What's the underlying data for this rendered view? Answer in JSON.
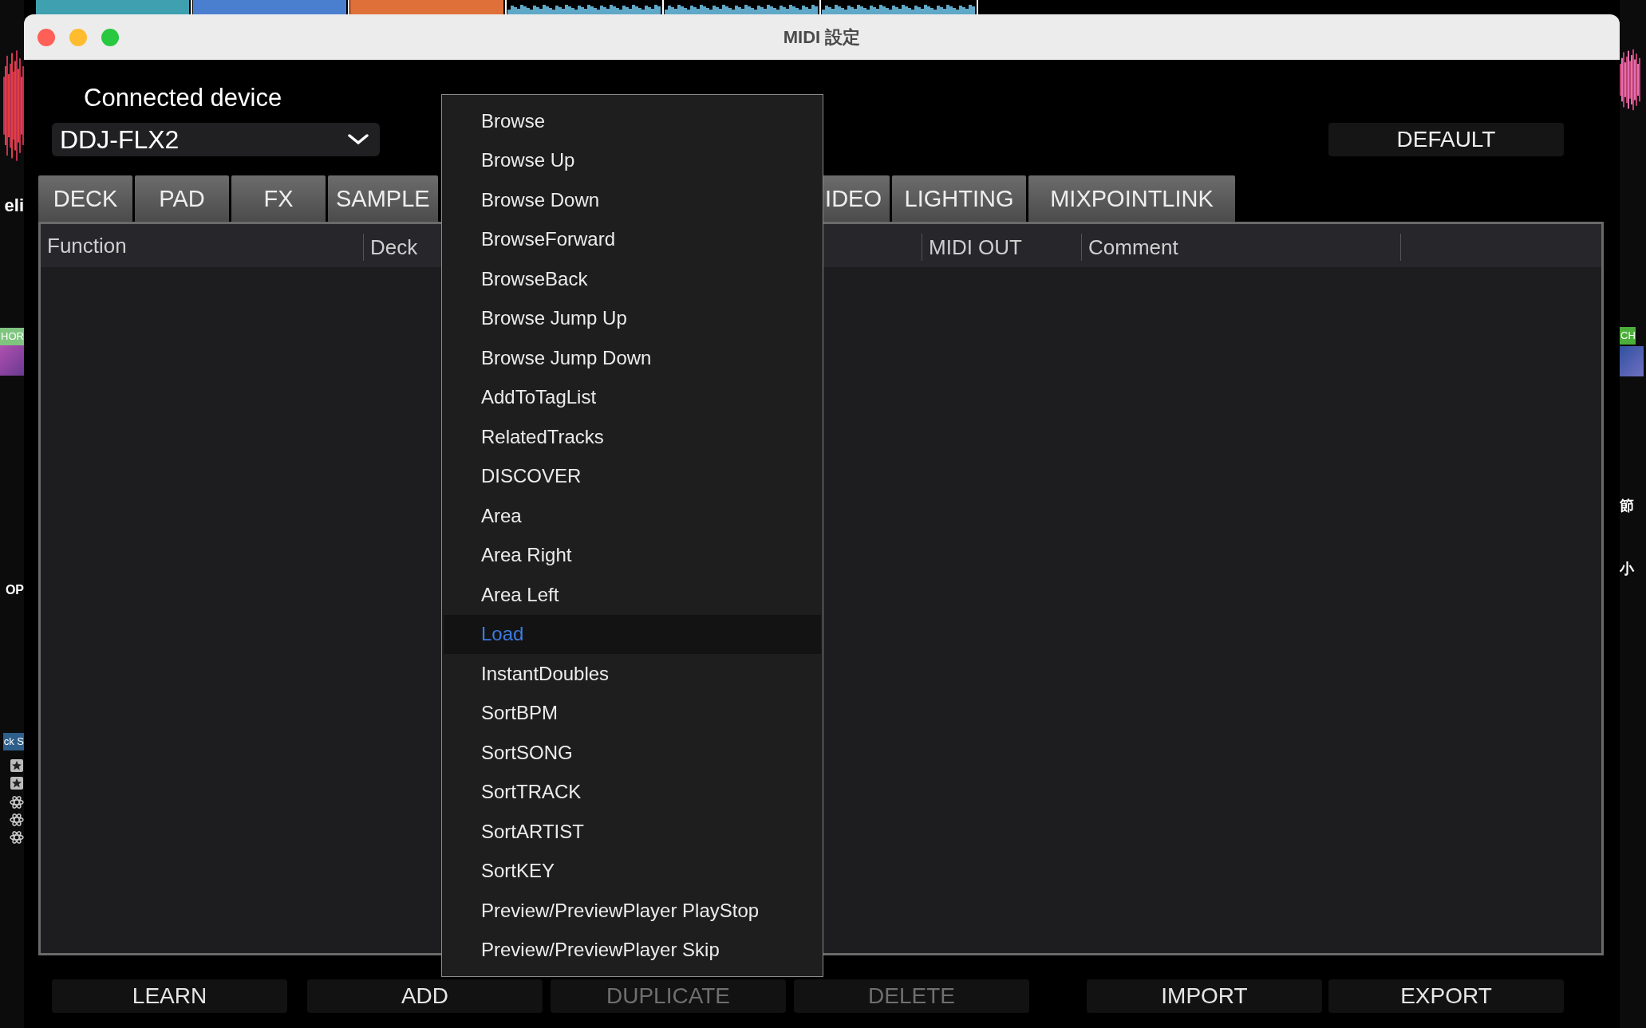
{
  "window": {
    "title": "MIDI 設定"
  },
  "device": {
    "label": "Connected device",
    "value": "DDJ-FLX2"
  },
  "default_button": "DEFAULT",
  "tabs": [
    {
      "label": "DECK",
      "selected": false
    },
    {
      "label": "PAD",
      "selected": false
    },
    {
      "label": "FX",
      "selected": false
    },
    {
      "label": "SAMPLE",
      "selected": false
    },
    {
      "label": "IDEO",
      "selected": false
    },
    {
      "label": "LIGHTING",
      "selected": false
    },
    {
      "label": "MIXPOINTLINK",
      "selected": false
    }
  ],
  "table": {
    "columns": [
      "Function",
      "Deck",
      "MIDI OUT",
      "Comment"
    ]
  },
  "menu": {
    "items": [
      {
        "label": "Browse",
        "selected": false
      },
      {
        "label": "Browse Up",
        "selected": false
      },
      {
        "label": "Browse Down",
        "selected": false
      },
      {
        "label": "BrowseForward",
        "selected": false
      },
      {
        "label": "BrowseBack",
        "selected": false
      },
      {
        "label": "Browse Jump Up",
        "selected": false
      },
      {
        "label": "Browse Jump Down",
        "selected": false
      },
      {
        "label": "AddToTagList",
        "selected": false
      },
      {
        "label": "RelatedTracks",
        "selected": false
      },
      {
        "label": "DISCOVER",
        "selected": false
      },
      {
        "label": "Area",
        "selected": false
      },
      {
        "label": "Area Right",
        "selected": false
      },
      {
        "label": "Area Left",
        "selected": false
      },
      {
        "label": "Load",
        "selected": true
      },
      {
        "label": "InstantDoubles",
        "selected": false
      },
      {
        "label": "SortBPM",
        "selected": false
      },
      {
        "label": "SortSONG",
        "selected": false
      },
      {
        "label": "SortTRACK",
        "selected": false
      },
      {
        "label": "SortARTIST",
        "selected": false
      },
      {
        "label": "SortKEY",
        "selected": false
      },
      {
        "label": "Preview/PreviewPlayer PlayStop",
        "selected": false
      },
      {
        "label": "Preview/PreviewPlayer Skip",
        "selected": false
      }
    ]
  },
  "buttons": [
    {
      "label": "LEARN",
      "disabled": false
    },
    {
      "label": "ADD",
      "disabled": false
    },
    {
      "label": "DUPLICATE",
      "disabled": true
    },
    {
      "label": "DELETE",
      "disabled": true
    },
    {
      "label": "IMPORT",
      "disabled": false
    },
    {
      "label": "EXPORT",
      "disabled": false
    }
  ],
  "left_strip": {
    "items": [
      {
        "kind": "waveform"
      },
      {
        "kind": "text",
        "text": "eli"
      },
      {
        "kind": "tag",
        "text": "HOR",
        "color": "#7fc47f"
      },
      {
        "kind": "artwork"
      },
      {
        "kind": "text",
        "text": "OP"
      },
      {
        "kind": "tag",
        "text": "ck S",
        "color": "#2e5f8a"
      },
      {
        "kind": "star"
      },
      {
        "kind": "star"
      },
      {
        "kind": "atom"
      },
      {
        "kind": "atom"
      },
      {
        "kind": "atom"
      }
    ]
  },
  "right_strip": {
    "items": [
      {
        "kind": "waveform"
      },
      {
        "kind": "tag",
        "text": "CH",
        "color": "#4caf3a"
      },
      {
        "kind": "artwork"
      },
      {
        "kind": "text",
        "text": "節"
      },
      {
        "kind": "text",
        "text": "小"
      }
    ]
  }
}
